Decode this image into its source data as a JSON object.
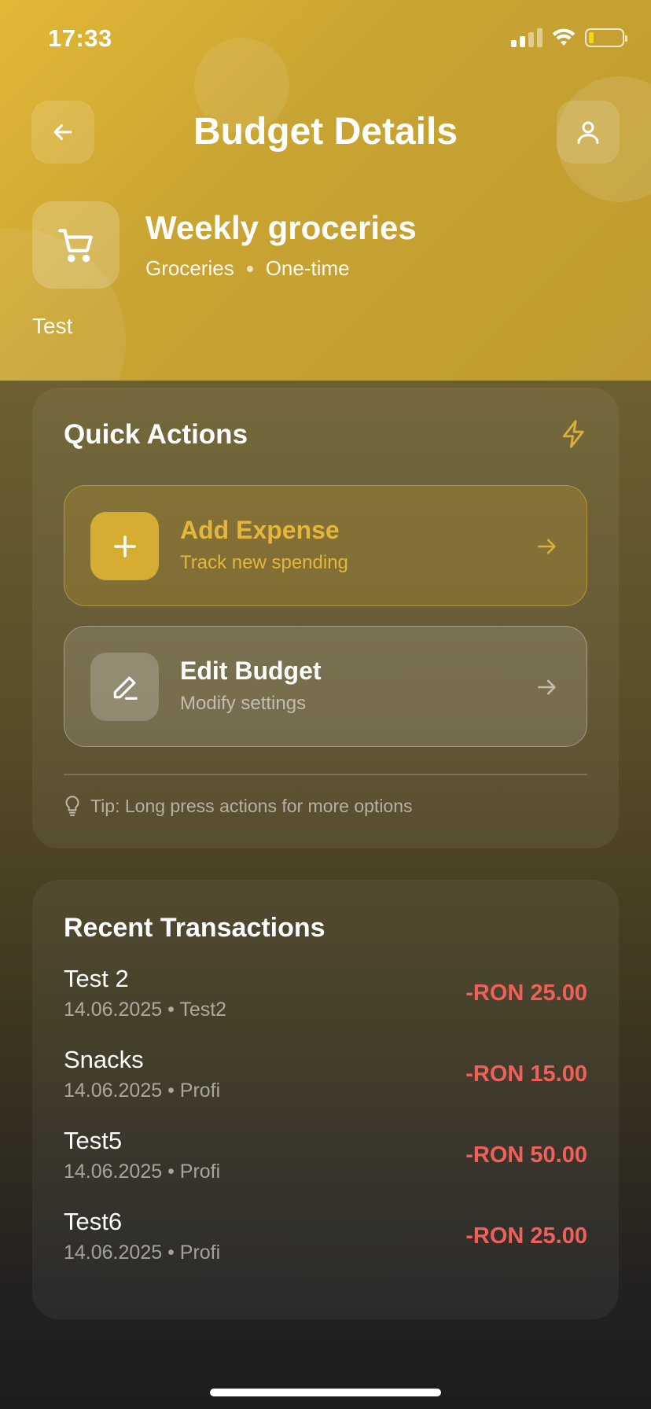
{
  "status_bar": {
    "time": "17:33",
    "battery_level": 0.15
  },
  "header": {
    "title": "Budget Details",
    "back_icon": "arrow-left-icon",
    "profile_icon": "user-icon"
  },
  "budget": {
    "icon": "shopping-cart-icon",
    "name": "Weekly groceries",
    "category": "Groceries",
    "recurrence": "One-time",
    "description": "Test"
  },
  "quick_actions": {
    "title": "Quick Actions",
    "icon": "lightning-icon",
    "add_expense": {
      "title": "Add Expense",
      "subtitle": "Track new spending",
      "icon": "plus-icon"
    },
    "edit_budget": {
      "title": "Edit Budget",
      "subtitle": "Modify settings",
      "icon": "pencil-icon"
    },
    "tip": "Tip: Long press actions for more options"
  },
  "recent_transactions": {
    "title": "Recent Transactions",
    "items": [
      {
        "name": "Test 2",
        "meta": "14.06.2025 • Test2",
        "amount": "-RON 25.00"
      },
      {
        "name": "Snacks",
        "meta": "14.06.2025 • Profi",
        "amount": "-RON 15.00"
      },
      {
        "name": "Test5",
        "meta": "14.06.2025 • Profi",
        "amount": "-RON 50.00"
      },
      {
        "name": "Test6",
        "meta": "14.06.2025 • Profi",
        "amount": "-RON 25.00"
      }
    ]
  },
  "colors": {
    "accent": "#d4ad32",
    "negative": "#f0605a",
    "header_bg": "#c9a432"
  }
}
